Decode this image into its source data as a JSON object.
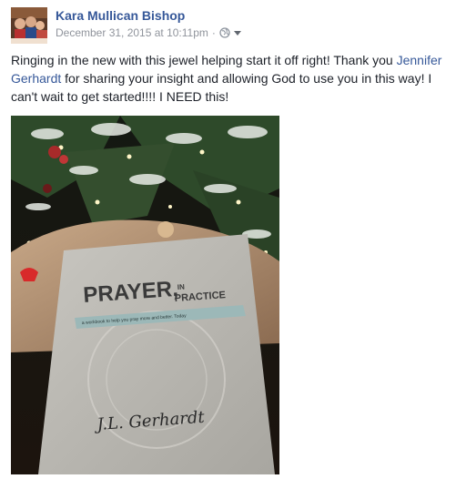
{
  "post": {
    "author": "Kara Mullican Bishop",
    "date": "December 31, 2015 at 10:11pm",
    "separator": "·",
    "privacy_icon": "globe-icon",
    "text_before": "Ringing in the new with this jewel helping start it off right! Thank you ",
    "mention": "Jennifer Gerhardt",
    "text_after": " for sharing your insight and allowing God to use you in this way! I can't wait to get started!!!! I NEED this!"
  },
  "photo": {
    "book_title_main": "PRAYER,",
    "book_title_in": "IN",
    "book_title_practice": "PRACTICE",
    "book_subtitle": "a workbook to help you pray more and better. Today",
    "book_author": "J.L. Gerhardt"
  },
  "colors": {
    "link": "#365899",
    "meta": "#90949c",
    "text": "#1d2129"
  }
}
